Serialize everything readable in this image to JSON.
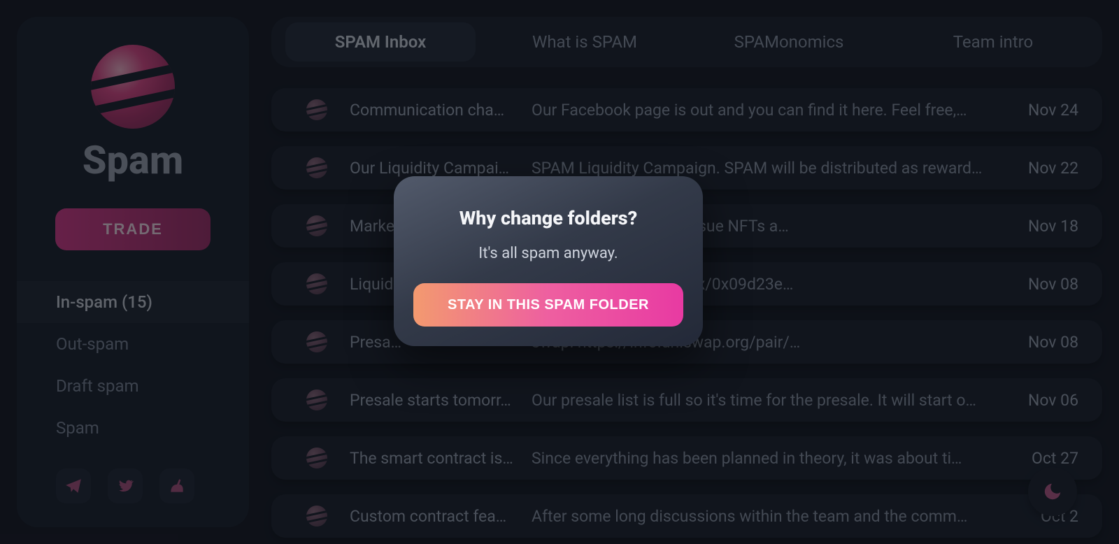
{
  "brand": "Spam",
  "sidebar": {
    "trade_label": "TRADE",
    "folders": [
      {
        "label": "In-spam (15)",
        "active": true
      },
      {
        "label": "Out-spam",
        "active": false
      },
      {
        "label": "Draft spam",
        "active": false
      },
      {
        "label": "Spam",
        "active": false
      }
    ],
    "socials": [
      "telegram-icon",
      "twitter-icon",
      "unicorn-icon"
    ]
  },
  "tabs": [
    {
      "label": "SPAM Inbox",
      "active": true
    },
    {
      "label": "What is SPAM",
      "active": false
    },
    {
      "label": "SPAMonomics",
      "active": false
    },
    {
      "label": "Team intro",
      "active": false
    }
  ],
  "emails": [
    {
      "subject": "Communication cha…",
      "preview": "Our Facebook page is out and you can find it here. Feel free,…",
      "date": "Nov 24"
    },
    {
      "subject": "Our Liquidity Campai…",
      "preview": "SPAM Liquidity Campaign. SPAM will be distributed as reward…",
      "date": "Nov 22"
    },
    {
      "subject": "Marke…",
      "preview": "ity campaign. We will issue NFTs a…",
      "date": "Nov 18"
    },
    {
      "subject": "Liquid…",
      "preview": "r: https://etherscan.io/tx/0x09d23e…",
      "date": "Nov 08"
    },
    {
      "subject": "Presa…",
      "preview": "swap: https://info.uniswap.org/pair/…",
      "date": "Nov 08"
    },
    {
      "subject": "Presale starts tomorr…",
      "preview": "Our presale list is full so it's time for the presale. It will start o…",
      "date": "Nov 06"
    },
    {
      "subject": "The smart contract is…",
      "preview": "Since everything has been planned in theory, it was about ti…",
      "date": "Oct 27"
    },
    {
      "subject": "Custom contract fea…",
      "preview": "After some long discussions within the team and the comm…",
      "date": "Oct 2"
    }
  ],
  "modal": {
    "title": "Why change folders?",
    "subtitle": "It's all spam anyway.",
    "button": "STAY IN THIS SPAM FOLDER"
  },
  "accent_gradient": [
    "#f39a6f",
    "#e83aa2"
  ]
}
